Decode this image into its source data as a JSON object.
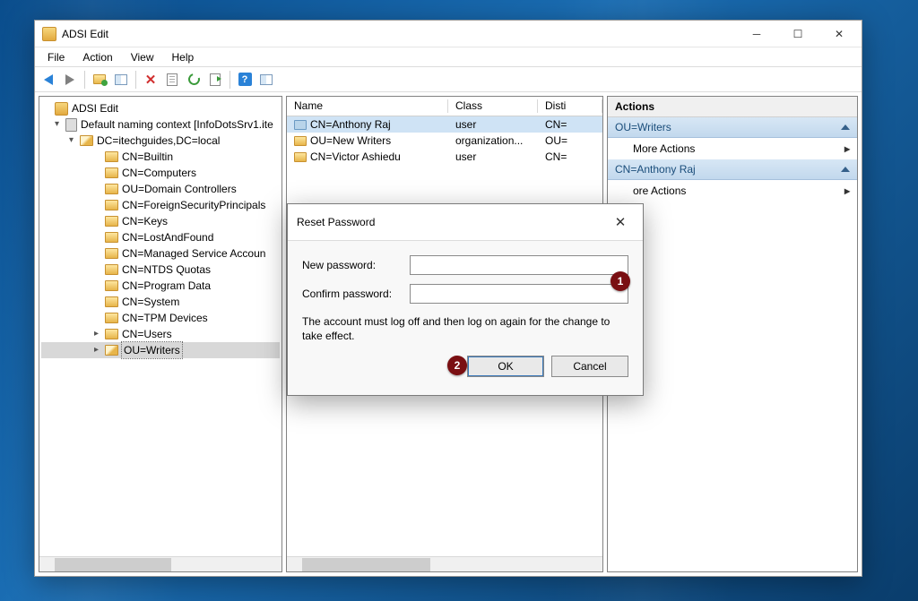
{
  "window": {
    "title": "ADSI Edit",
    "menu": [
      "File",
      "Action",
      "View",
      "Help"
    ]
  },
  "tree": {
    "root": "ADSI Edit",
    "context": "Default naming context [InfoDotsSrv1.ite",
    "domain": "DC=itechguides,DC=local",
    "children": [
      "CN=Builtin",
      "CN=Computers",
      "OU=Domain Controllers",
      "CN=ForeignSecurityPrincipals",
      "CN=Keys",
      "CN=LostAndFound",
      "CN=Managed Service Accoun",
      "CN=NTDS Quotas",
      "CN=Program Data",
      "CN=System",
      "CN=TPM Devices",
      "CN=Users",
      "OU=Writers"
    ],
    "selected": "OU=Writers"
  },
  "list": {
    "columns": {
      "name": "Name",
      "class": "Class",
      "dn": "Disti"
    },
    "rows": [
      {
        "name": "CN=Anthony Raj",
        "class": "user",
        "dn": "CN=",
        "selected": true
      },
      {
        "name": "OU=New Writers",
        "class": "organization...",
        "dn": "OU="
      },
      {
        "name": "CN=Victor Ashiedu",
        "class": "user",
        "dn": "CN="
      }
    ]
  },
  "actions": {
    "title": "Actions",
    "section1": "OU=Writers",
    "more1": "More Actions",
    "section2": "CN=Anthony Raj",
    "more2_suffix": "ore Actions"
  },
  "dialog": {
    "title": "Reset Password",
    "new_label": "New password:",
    "confirm_label": "Confirm password:",
    "note": "The account must log off and then log on again for the change to take effect.",
    "ok": "OK",
    "cancel": "Cancel",
    "callout1": "1",
    "callout2": "2"
  }
}
